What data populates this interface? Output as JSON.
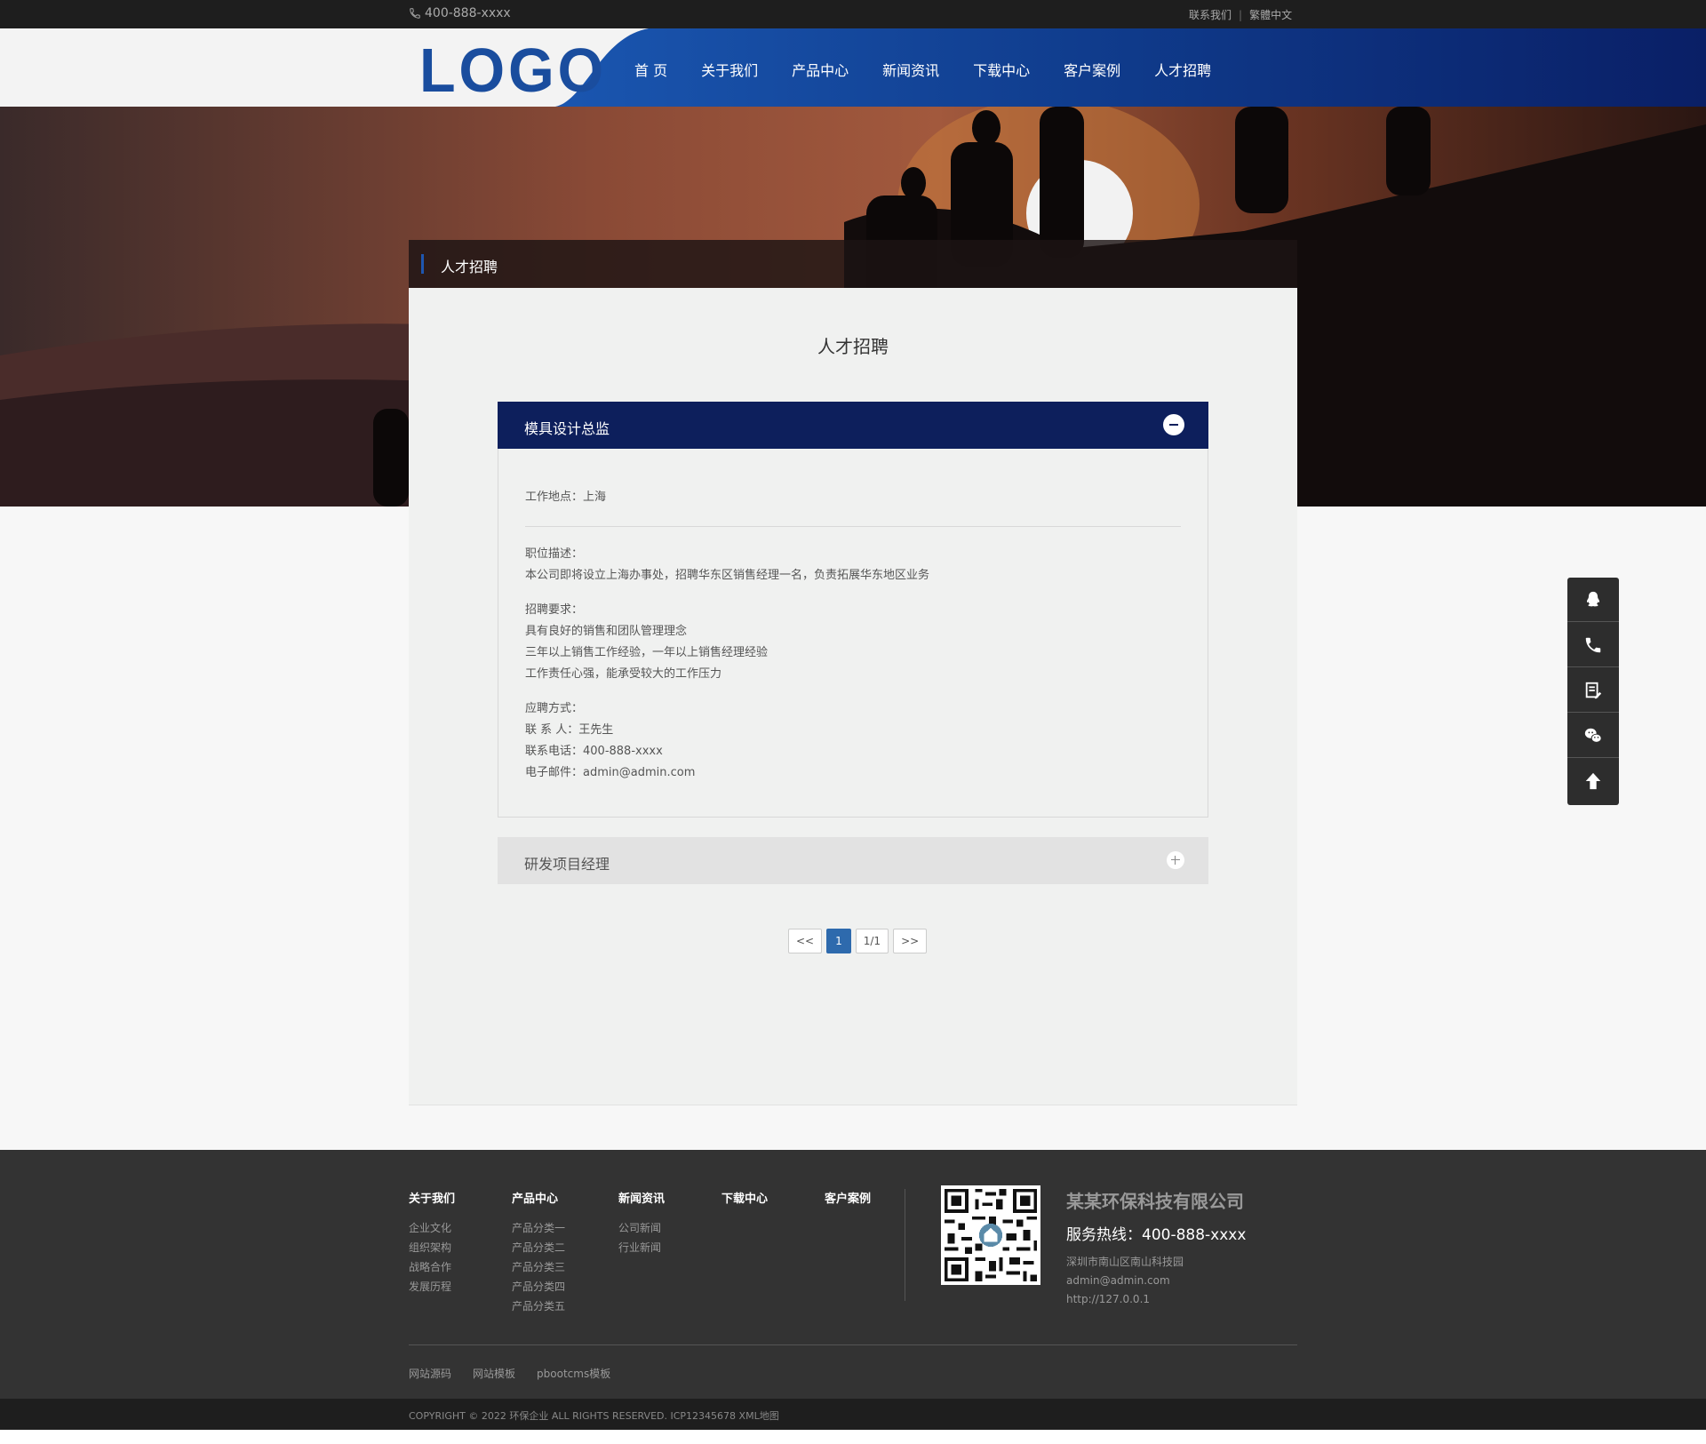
{
  "topbar": {
    "phone": "400-888-xxxx",
    "links": [
      "联系我们",
      "繁體中文"
    ]
  },
  "header": {
    "logo": "LOGO",
    "nav": [
      "首 页",
      "关于我们",
      "产品中心",
      "新闻资讯",
      "下载中心",
      "客户案例",
      "人才招聘"
    ]
  },
  "breadcrumb": {
    "label": "人才招聘"
  },
  "page": {
    "title": "人才招聘"
  },
  "jobs": [
    {
      "title": "模具设计总监",
      "expanded": true,
      "location": "工作地点：上海",
      "desc_label": "职位描述：",
      "desc": "本公司即将设立上海办事处，招聘华东区销售经理一名，负责拓展华东地区业务",
      "req_label": "招聘要求：",
      "reqs": [
        "具有良好的销售和团队管理理念",
        "三年以上销售工作经验，一年以上销售经理经验",
        "工作责任心强，能承受较大的工作压力"
      ],
      "apply_label": "应聘方式：",
      "contact": "联 系 人：王先生",
      "tel": "联系电话：400-888-xxxx",
      "email": "电子邮件：admin@admin.com"
    },
    {
      "title": "研发项目经理",
      "expanded": false
    }
  ],
  "pager": {
    "prev": "<<",
    "current": "1",
    "total": "1/1",
    "next": ">>"
  },
  "sidebar": [
    "qq-icon",
    "phone-icon",
    "message-icon",
    "wechat-icon",
    "back-to-top-icon"
  ],
  "footer": {
    "columns": [
      {
        "title": "关于我们",
        "links": [
          "企业文化",
          "组织架构",
          "战略合作",
          "发展历程"
        ]
      },
      {
        "title": "产品中心",
        "links": [
          "产品分类一",
          "产品分类二",
          "产品分类三",
          "产品分类四",
          "产品分类五"
        ]
      },
      {
        "title": "新闻资讯",
        "links": [
          "公司新闻",
          "行业新闻"
        ]
      },
      {
        "title": "下载中心",
        "links": []
      },
      {
        "title": "客户案例",
        "links": []
      }
    ],
    "company": "某某环保科技有限公司",
    "hotline": "服务热线：400-888-xxxx",
    "address": "深圳市南山区南山科技园",
    "email": "admin@admin.com",
    "url": "http://127.0.0.1",
    "friend_links": [
      "网站源码",
      "网站模板",
      "pbootcms模板"
    ],
    "copyright": "COPYRIGHT © 2022 环保企业 ALL RIGHTS RESERVED. ICP12345678 XML地图"
  },
  "colors": {
    "nav_blue": "#0d2a6e",
    "accent": "#0d1f5c",
    "pager_active": "#2e6aad"
  }
}
